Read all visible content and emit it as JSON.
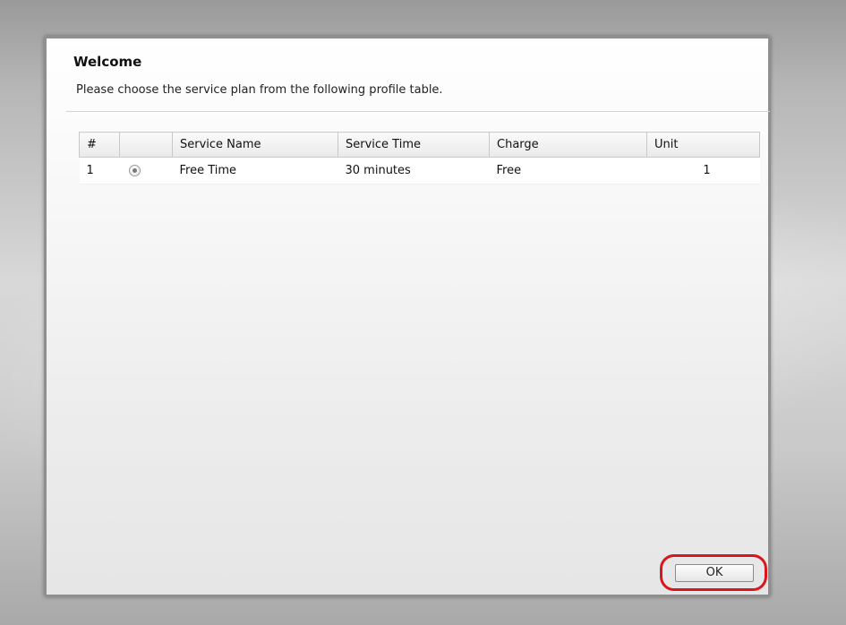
{
  "dialog": {
    "title": "Welcome",
    "subtitle": "Please choose the service plan from the following profile table."
  },
  "table": {
    "headers": {
      "num": "#",
      "select": "",
      "service_name": "Service Name",
      "service_time": "Service Time",
      "charge": "Charge",
      "unit": "Unit"
    },
    "rows": [
      {
        "num": "1",
        "selected": true,
        "service_name": "Free Time",
        "service_time": "30 minutes",
        "charge": "Free",
        "unit": "1"
      }
    ]
  },
  "actions": {
    "ok_label": "OK"
  },
  "colors": {
    "highlight_outline": "#d9161c"
  }
}
